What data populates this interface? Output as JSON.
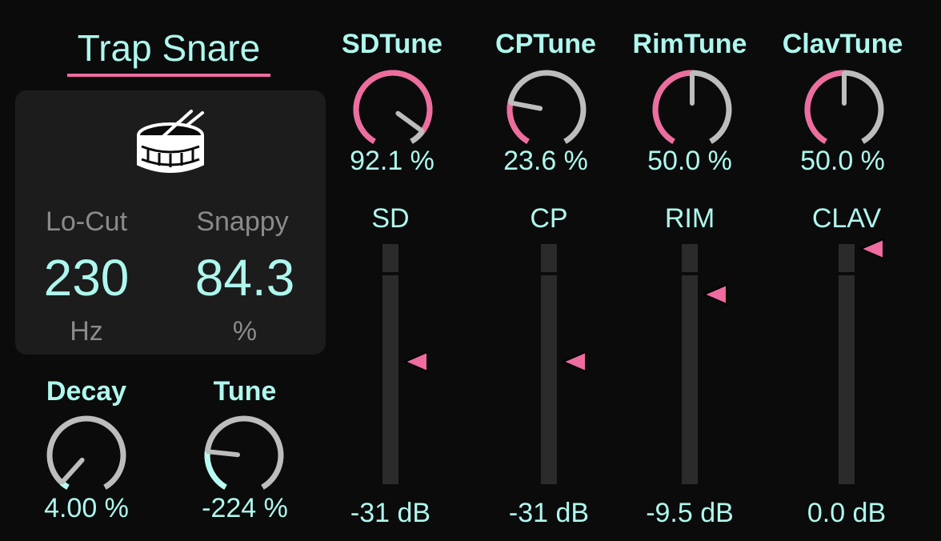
{
  "device": {
    "title": "Trap Snare",
    "icon": "snare-drum-icon"
  },
  "panel": {
    "locut": {
      "label": "Lo-Cut",
      "value": "230",
      "unit": "Hz"
    },
    "snappy": {
      "label": "Snappy",
      "value": "84.3",
      "unit": "%"
    }
  },
  "knobs": {
    "decay": {
      "label": "Decay",
      "value": "4.00 %",
      "norm": 0.04,
      "bipolar": false,
      "accent": "#b8fbf1"
    },
    "tune": {
      "label": "Tune",
      "value": "-224 %",
      "norm": 0.22,
      "bipolar": false,
      "accent": "#b8fbf1"
    },
    "sdtune": {
      "label": "SDTune",
      "value": "92.1 %",
      "norm": 0.921,
      "bipolar": false,
      "accent": "#ee6d9f"
    },
    "cptune": {
      "label": "CPTune",
      "value": "23.6 %",
      "norm": 0.236,
      "bipolar": false,
      "accent": "#ee6d9f"
    },
    "rimtune": {
      "label": "RimTune",
      "value": "50.0 %",
      "norm": 0.5,
      "bipolar": false,
      "accent": "#ee6d9f"
    },
    "clavtune": {
      "label": "ClavTune",
      "value": "50.0 %",
      "norm": 0.5,
      "bipolar": false,
      "accent": "#ee6d9f"
    }
  },
  "channels": [
    {
      "label": "SD",
      "value": "-31 dB",
      "level": 0.51
    },
    {
      "label": "CP",
      "value": "-31 dB",
      "level": 0.51
    },
    {
      "label": "RIM",
      "value": "-9.5 dB",
      "level": 0.79
    },
    {
      "label": "CLAV",
      "value": "0.0 dB",
      "level": 0.98
    }
  ],
  "colors": {
    "accent_teal": "#aef8ee",
    "accent_pink": "#f06ba0",
    "knob_track": "#bdbdbd",
    "background": "#0b0b0b",
    "panel": "#1c1c1c"
  }
}
